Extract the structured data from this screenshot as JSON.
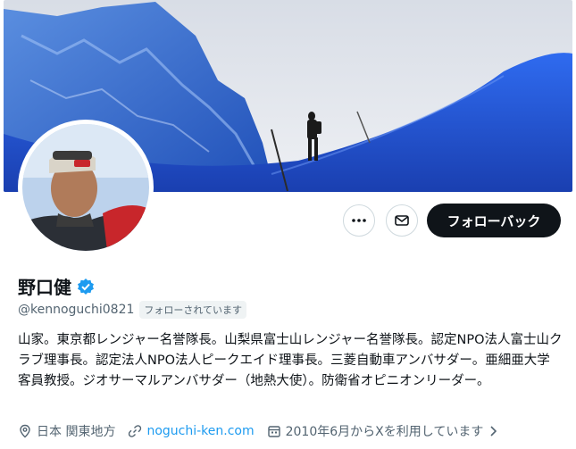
{
  "profile": {
    "display_name": "野口健",
    "handle": "@kennoguchi0821",
    "follows_you_badge": "フォローされています",
    "verified_icon": "verified-badge-icon",
    "bio": "山家。東京都レンジャー名誉隊長。山梨県富士山レンジャー名誉隊長。認定NPO法人富士山クラブ理事長。認定法人NPO法人ピークエイド理事長。三菱自動車アンバサダー。亜細亜大学客員教授。ジオサーマルアンバサダー（地熱大使）。防衛省オピニオンリーダー。",
    "location": "日本 関東地方",
    "website": "noguchi-ken.com",
    "joined": "2010年6月からXを利用しています"
  },
  "actions": {
    "more_icon": "more-icon",
    "message_icon": "mail-icon",
    "follow_back_label": "フォローバック"
  },
  "colors": {
    "accent": "#1d9bf0",
    "primary_button": "#0f1419",
    "secondary_text": "#536471"
  }
}
